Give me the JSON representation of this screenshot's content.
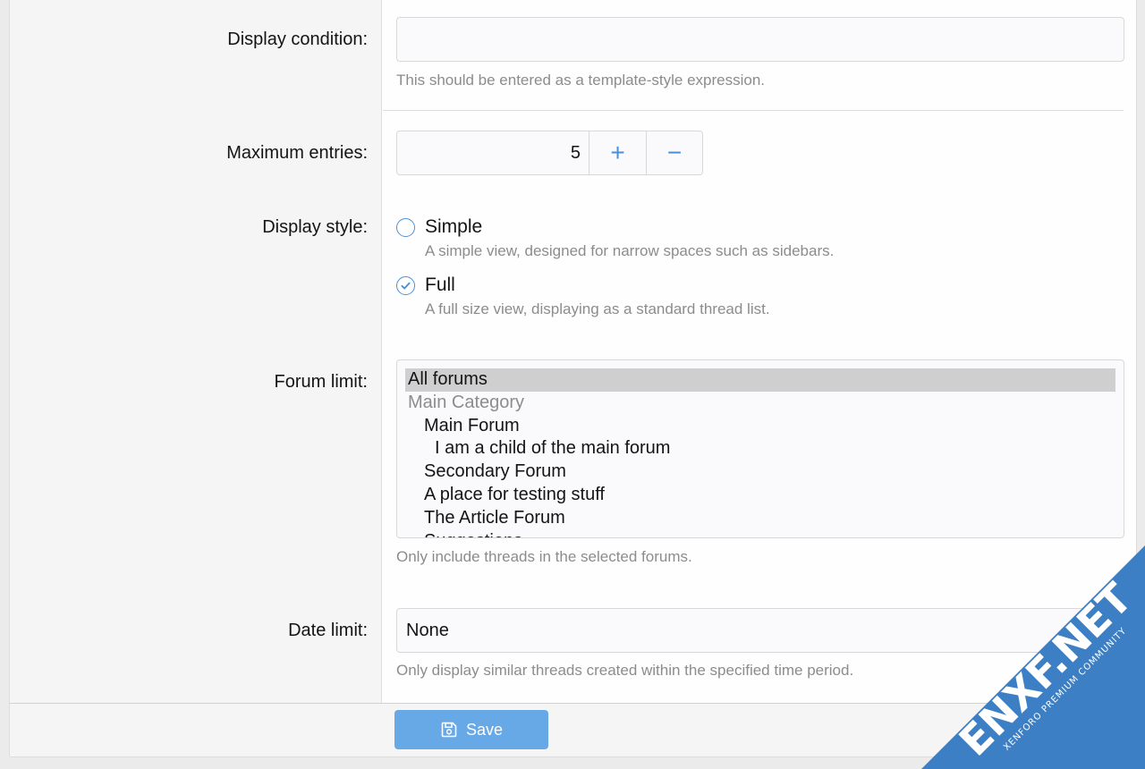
{
  "form": {
    "display_condition": {
      "label": "Display condition:",
      "value": "",
      "hint": "This should be entered as a template-style expression."
    },
    "max_entries": {
      "label": "Maximum entries:",
      "value": "5",
      "increment_symbol": "+",
      "decrement_symbol": "−"
    },
    "display_style": {
      "label": "Display style:",
      "options": [
        {
          "label": "Simple",
          "hint": "A simple view, designed for narrow spaces such as sidebars.",
          "selected": false
        },
        {
          "label": "Full",
          "hint": "A full size view, displaying as a standard thread list.",
          "selected": true
        }
      ]
    },
    "forum_limit": {
      "label": "Forum limit:",
      "options": [
        "All forums",
        "Main Category",
        "Main Forum",
        "I am a child of the main forum",
        "Secondary Forum",
        "A place for testing stuff",
        "The Article Forum",
        "Suggestions"
      ],
      "hint": "Only include threads in the selected forums."
    },
    "date_limit": {
      "label": "Date limit:",
      "value": "None",
      "hint": "Only display similar threads created within the specified time period."
    }
  },
  "footer": {
    "save_label": "Save"
  },
  "watermark": {
    "text": "ENXF.NET",
    "subtext": "XENFORO PREMIUM COMMUNITY"
  },
  "colors": {
    "accent": "#4a8fd6",
    "save_button": "#67a8e6",
    "label_bg": "#f5f5f5"
  },
  "icons": {
    "save": "floppy-disk-icon",
    "radio_checked": "check-icon"
  }
}
